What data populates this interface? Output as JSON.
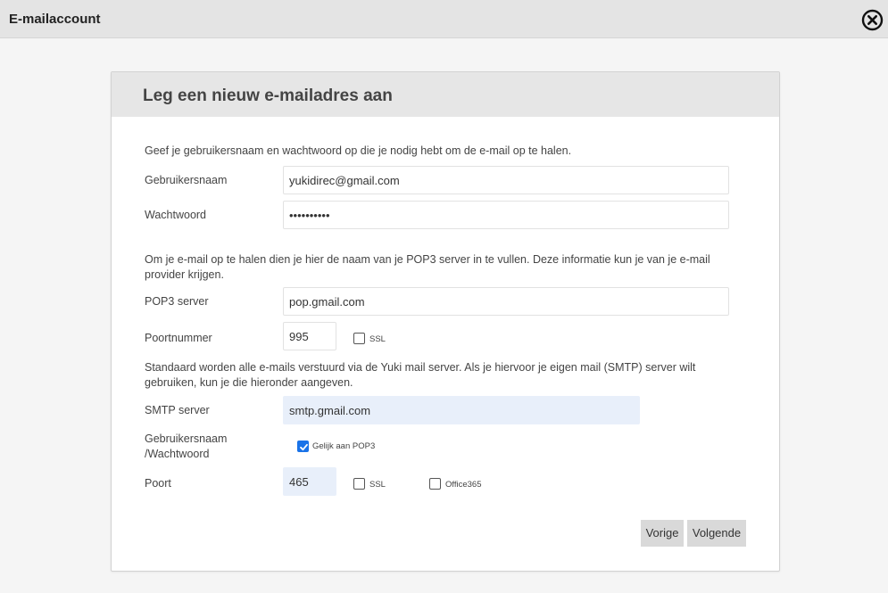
{
  "window": {
    "title": "E-mailaccount"
  },
  "panel": {
    "heading": "Leg een nieuw e-mailadres aan",
    "intro_credentials": "Geef je gebruikersnaam en wachtwoord op die je nodig hebt om de e-mail op te halen.",
    "username_label": "Gebruikersnaam",
    "username_value": "yukidirec@gmail.com",
    "password_label": "Wachtwoord",
    "password_value": "••••••••••",
    "intro_pop3": "Om je e-mail op te halen dien je hier de naam van je POP3 server in te vullen. Deze informatie kun je van je e-mail provider krijgen.",
    "pop3_label": "POP3 server",
    "pop3_value": "pop.gmail.com",
    "port_label": "Poortnummer",
    "port_value": "995",
    "pop3_ssl_label": "SSL",
    "pop3_ssl_checked": false,
    "intro_smtp": "Standaard worden alle e-mails verstuurd via de Yuki mail server. Als je hiervoor je eigen mail (SMTP) server wilt gebruiken, kun je die hieronder aangeven.",
    "smtp_label": "SMTP server",
    "smtp_value": "smtp.gmail.com",
    "smtp_credentials_label_line1": "Gebruikersnaam",
    "smtp_credentials_label_line2": "/Wachtwoord",
    "same_as_pop3_label": "Gelijk aan POP3",
    "same_as_pop3_checked": true,
    "smtp_port_label": "Poort",
    "smtp_port_value": "465",
    "smtp_ssl_label": "SSL",
    "smtp_ssl_checked": false,
    "office365_label": "Office365",
    "office365_checked": false,
    "prev_button": "Vorige",
    "next_button": "Volgende"
  },
  "colors": {
    "checkbox_checked": "#1a73e8",
    "highlight_input": "#e8effa",
    "header_bg": "#e6e6e6"
  },
  "icons": {
    "close": "close-circle-icon",
    "check": "checkmark-icon"
  }
}
